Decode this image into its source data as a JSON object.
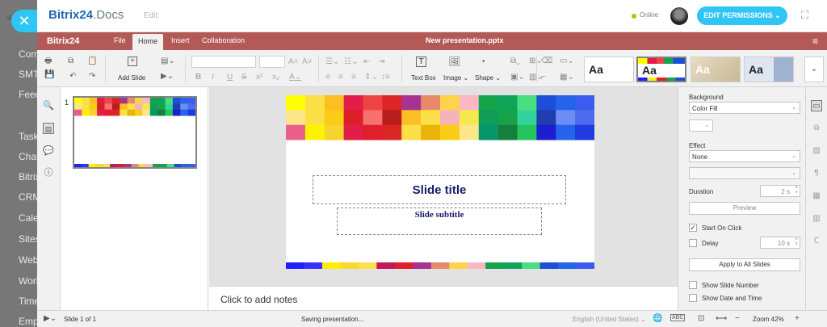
{
  "background_sidebar": {
    "items": [
      "Com",
      "SMT",
      "Feed",
      "Tasks",
      "Chat",
      "Bitrix",
      "CRM",
      "Cale",
      "Sites",
      "Web",
      "Work",
      "Time",
      "Emp"
    ]
  },
  "header": {
    "brand_main": "Bitrix24",
    "brand_sub": ".Docs",
    "edit_label": "Edit",
    "online_label": "Online",
    "permissions_button": "EDIT PERMISSIONS"
  },
  "menubar": {
    "logo": "Bitrix24",
    "tabs": [
      "File",
      "Home",
      "Insert",
      "Collaboration"
    ],
    "active_tab": "Home",
    "document_title": "New presentation.pptx"
  },
  "toolbar": {
    "add_slide_label": "Add Slide",
    "text_box_label": "Text Box",
    "image_label": "Image",
    "shape_label": "Shape",
    "theme_label": "Aa"
  },
  "thumbnails": {
    "slide_number": "1"
  },
  "slide": {
    "title": "Slide title",
    "subtitle": "Slide subtitle",
    "top_colors": [
      [
        "#ffff00",
        "#fde047",
        "#fbbf24",
        "#e11d48",
        "#ef4444",
        "#dc2626",
        "#a6338f",
        "#e9896b",
        "#fcd34d",
        "#f9b8c4",
        "#16a34a",
        "#0ea55a",
        "#4ade80",
        "#1d4ed8",
        "#2563eb",
        "#3b5cf0"
      ],
      [
        "#fde68a",
        "#fde047",
        "#facc15",
        "#dc1f26",
        "#f87171",
        "#b91c1c",
        "#fbbf24",
        "#fde047",
        "#f5b4bb",
        "#f5e84d",
        "#0f9d58",
        "#16a34a",
        "#34d399",
        "#1e40af",
        "#6d8cf5",
        "#4f6bed"
      ],
      [
        "#e8608a",
        "#fdf300",
        "#f6d32d",
        "#e11d48",
        "#e11d2e",
        "#dc2626",
        "#fde047",
        "#eab308",
        "#facc15",
        "#fde68a",
        "#059669",
        "#15803d",
        "#22c55e",
        "#1d1dd1",
        "#2563eb",
        "#1e3ae0"
      ]
    ],
    "bottom_colors": [
      "#2020ff",
      "#3333ff",
      "#ffee00",
      "#fbd82d",
      "#fde047",
      "#c2185b",
      "#e11d2e",
      "#a6338f",
      "#e9896b",
      "#fcd34d",
      "#f9b8c4",
      "#16a34a",
      "#0ea55a",
      "#4ade80",
      "#1d4ed8",
      "#2563eb",
      "#3b5cf0"
    ]
  },
  "notes": {
    "placeholder": "Click to add notes"
  },
  "settings": {
    "background_label": "Background",
    "background_value": "Color Fill",
    "effect_label": "Effect",
    "effect_value": "None",
    "duration_label": "Duration",
    "duration_value": "2 s",
    "preview_button": "Preview",
    "start_on_click_label": "Start On Click",
    "start_on_click_checked": true,
    "delay_label": "Delay",
    "delay_value": "10 s",
    "delay_checked": false,
    "apply_all_button": "Apply to All Slides",
    "show_slide_number_label": "Show Slide Number",
    "show_date_time_label": "Show Date and Time"
  },
  "statusbar": {
    "slide_counter": "Slide 1 of 1",
    "saving_text": "Saving presentation...",
    "language": "English (United States)",
    "zoom_label": "Zoom 42%"
  }
}
